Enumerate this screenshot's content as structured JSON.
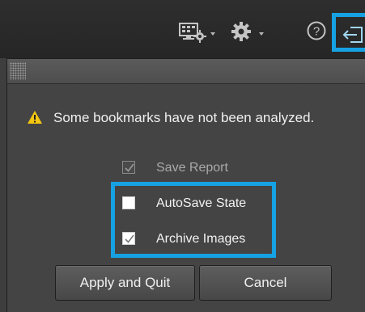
{
  "toolbar": {
    "icons": [
      "monitor-settings-icon",
      "gear-icon",
      "help-icon",
      "exit-icon"
    ]
  },
  "dialog": {
    "warning": {
      "icon": "warning-triangle-icon",
      "text": "Some bookmarks have not been analyzed."
    },
    "options": [
      {
        "label": "Save Report",
        "checked": true,
        "enabled": false
      },
      {
        "label": "AutoSave State",
        "checked": false,
        "enabled": true
      },
      {
        "label": "Archive Images",
        "checked": true,
        "enabled": true
      }
    ],
    "buttons": {
      "apply": "Apply and Quit",
      "cancel": "Cancel"
    }
  },
  "colors": {
    "highlight": "#16a1e3",
    "warning": "#f3c611",
    "background": "#444444"
  }
}
